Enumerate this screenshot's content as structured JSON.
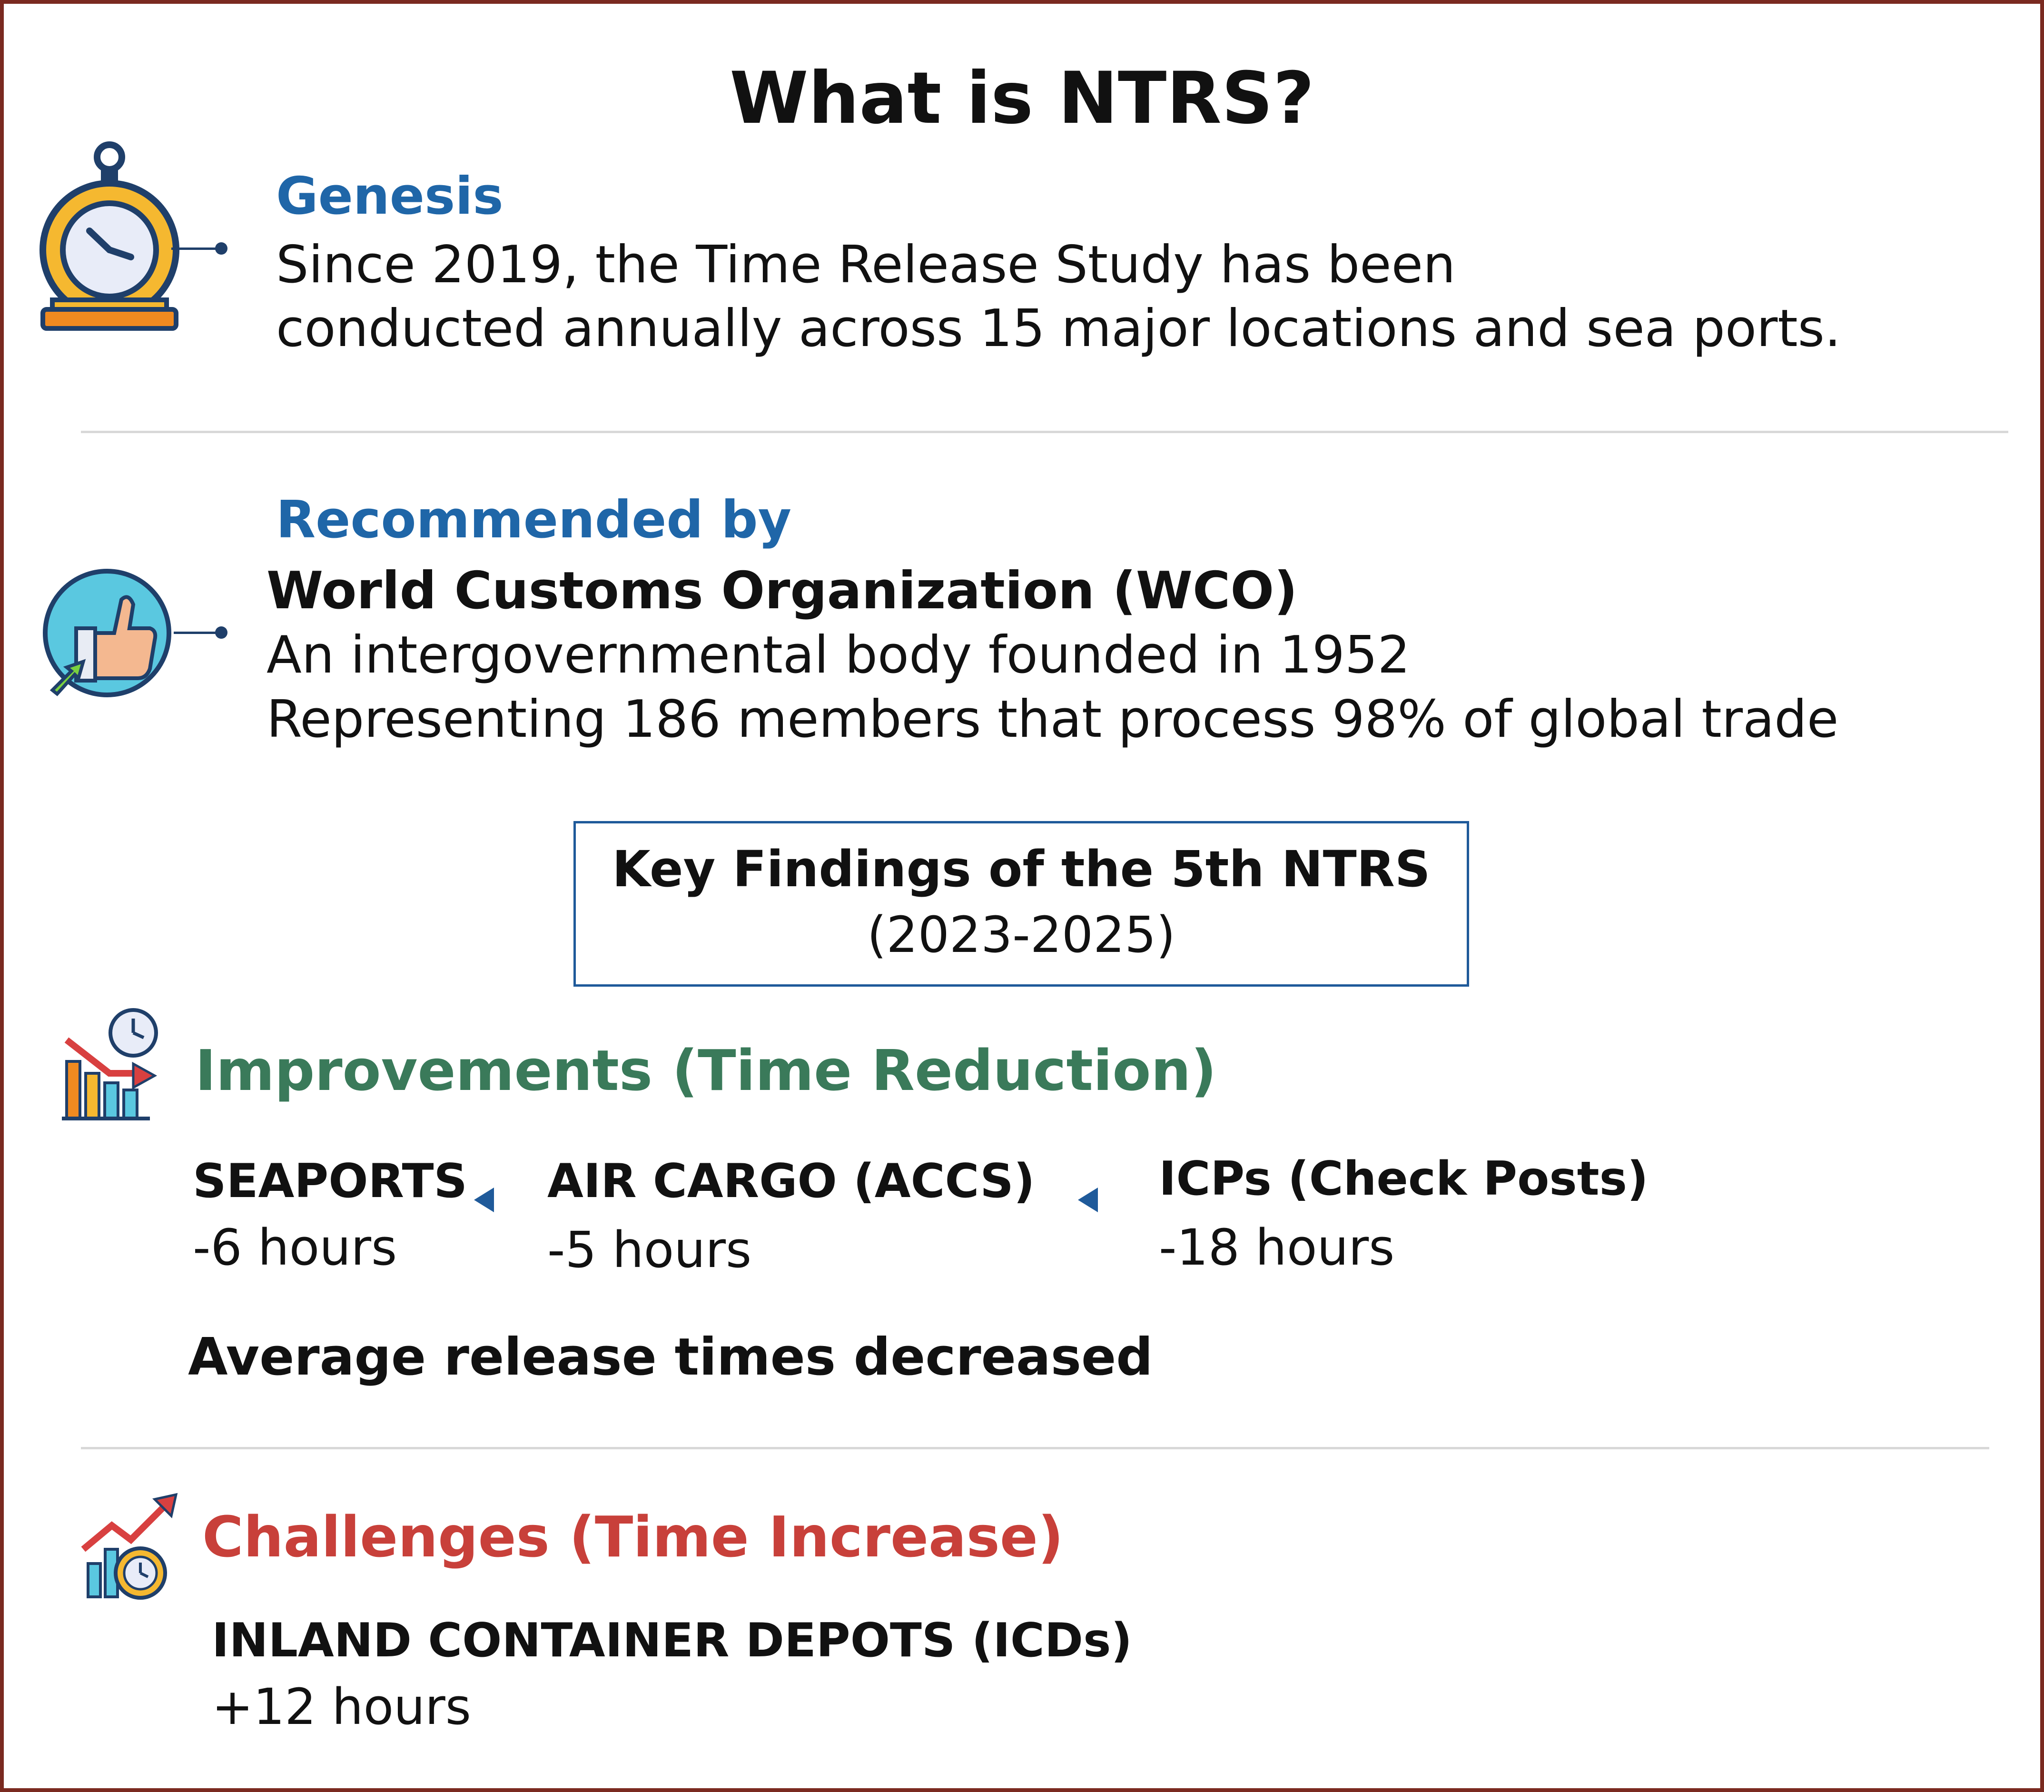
{
  "title": "What is NTRS?",
  "genesis": {
    "heading": "Genesis",
    "line1": "Since 2019, the Time Release Study has been",
    "line2": "conducted annually across 15 major locations and sea ports.",
    "icon": "stopwatch-icon"
  },
  "recommended": {
    "heading": "Recommended by",
    "org": "World Customs Organization (WCO)",
    "line1": "An intergovernmental body founded in 1952",
    "line2": "Representing 186 members that process 98% of global trade",
    "icon": "thumbs-up-icon"
  },
  "key_findings": {
    "title": "Key Findings of the 5th NTRS",
    "period": "(2023-2025)"
  },
  "improvements": {
    "heading": "Improvements (Time Reduction)",
    "icon": "declining-chart-clock-icon",
    "items": [
      {
        "label": "SEAPORTS",
        "value": "-6 hours"
      },
      {
        "label": "AIR CARGO (ACCS)",
        "value": "-5 hours"
      },
      {
        "label": "ICPs (Check Posts)",
        "value": "-18 hours"
      }
    ],
    "summary": "Average release times decreased"
  },
  "challenges": {
    "heading": "Challenges (Time Increase)",
    "icon": "rising-chart-clock-icon",
    "items": [
      {
        "label": "INLAND CONTAINER DEPOTS (ICDs)",
        "value": "+12 hours"
      }
    ]
  },
  "colors": {
    "border": "#7a2a20",
    "heading_blue": "#1f66a8",
    "heading_green": "#3a7a5a",
    "heading_red": "#c8403a",
    "box_border": "#1f5a9a"
  }
}
